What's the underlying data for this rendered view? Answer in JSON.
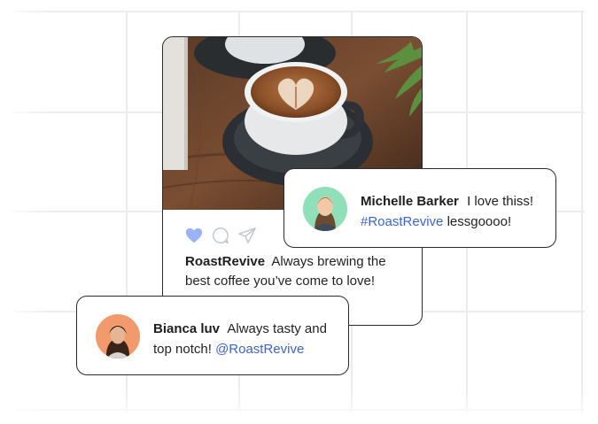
{
  "post": {
    "username": "RoastRevive",
    "caption": "Always brewing the best coffee you’ve come to love!"
  },
  "comments": {
    "michelle": {
      "name": "Michelle Barker",
      "text": "I love thiss!",
      "hashtag": "#RoastRevive",
      "text_after": "lessgoooo!"
    },
    "bianca": {
      "name": "Bianca luv",
      "text": "Always tasty and top notch!",
      "mention": "@RoastRevive"
    }
  },
  "icons": {
    "like": "heart-icon",
    "comment": "comment-bubble-icon",
    "share": "send-icon"
  },
  "colors": {
    "accent": "#3a63d8",
    "heart": "#9bb3f4",
    "border": "#2b2b2b"
  }
}
